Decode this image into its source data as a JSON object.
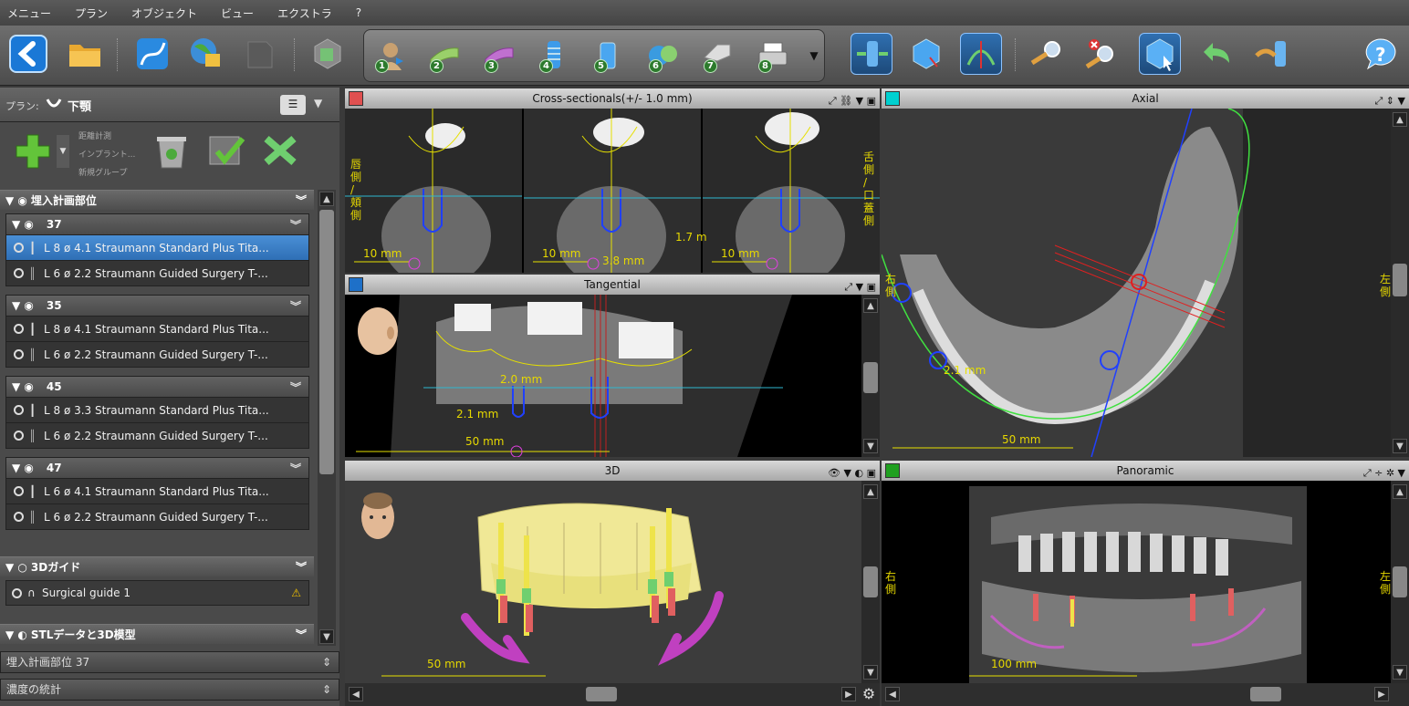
{
  "menu": [
    "メニュー",
    "プラン",
    "オブジェクト",
    "ビュー",
    "エクストラ",
    "?"
  ],
  "plan": {
    "label": "プラン:",
    "name": "下顎",
    "actions": [
      "距離計測",
      "インプラント...",
      "新規グループ"
    ]
  },
  "implant_section": {
    "title": "埋入計画部位",
    "groups": [
      {
        "site": "37",
        "rows": [
          {
            "text": "L 8  ø 4.1   Straumann Standard Plus Tita...",
            "selected": true
          },
          {
            "text": "L 6  ø 2.2   Straumann Guided Surgery T-...",
            "selected": false
          }
        ]
      },
      {
        "site": "35",
        "rows": [
          {
            "text": "L 8  ø 4.1   Straumann Standard Plus Tita...",
            "selected": false
          },
          {
            "text": "L 6  ø 2.2   Straumann Guided Surgery T-...",
            "selected": false
          }
        ]
      },
      {
        "site": "45",
        "rows": [
          {
            "text": "L 8  ø 3.3   Straumann Standard Plus Tita...",
            "selected": false
          },
          {
            "text": "L 6  ø 2.2   Straumann Guided Surgery T-...",
            "selected": false
          }
        ]
      },
      {
        "site": "47",
        "rows": [
          {
            "text": "L 6  ø 4.1   Straumann Standard Plus Tita...",
            "selected": false
          },
          {
            "text": "L 6  ø 2.2   Straumann Guided Surgery T-...",
            "selected": false
          }
        ]
      }
    ]
  },
  "guide_section": {
    "title": "3Dガイド",
    "item": "Surgical guide 1"
  },
  "stl_section": {
    "title": "STLデータと3D模型"
  },
  "combos": [
    "埋入計画部位 37",
    "濃度の統計"
  ],
  "views": {
    "cross": {
      "title": "Cross-sectionals(+/- 1.0 mm)",
      "color": "#e05050",
      "side_left": "唇\n側\n/\n頬\n側",
      "side_right": "舌\n側\n/\n口\n蓋\n側",
      "scale": "10 mm",
      "m1": "3.8 mm",
      "m2": "1.7 m"
    },
    "axial": {
      "title": "Axial",
      "color": "#00d0d0",
      "left": "右\n側",
      "right": "左\n側",
      "m1": "2.1 mm",
      "scale": "50 mm"
    },
    "tangential": {
      "title": "Tangential",
      "color": "#1e70c8",
      "m1": "2.0 mm",
      "m2": "2.1 mm",
      "scale": "50 mm"
    },
    "v3d": {
      "title": "3D",
      "scale": "50 mm"
    },
    "panoramic": {
      "title": "Panoramic",
      "color": "#20a020",
      "left": "右\n側",
      "right": "左\n側",
      "scale": "100 mm"
    }
  }
}
